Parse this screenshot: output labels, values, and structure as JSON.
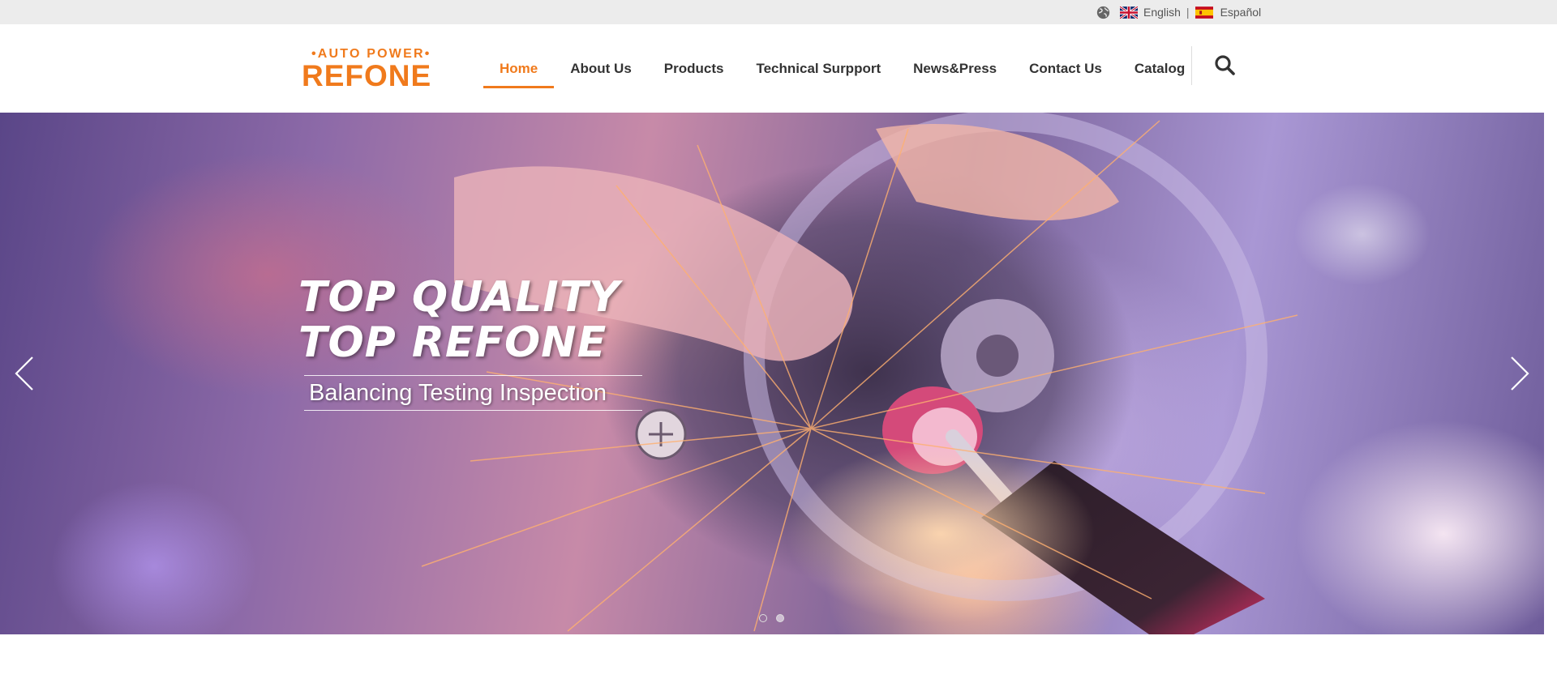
{
  "language_bar": {
    "icon": "globe-icon",
    "languages": [
      {
        "label": "English",
        "flag": "uk-flag-icon"
      },
      {
        "label": "Español",
        "flag": "spain-flag-icon"
      }
    ],
    "separator": "|"
  },
  "header": {
    "logo": {
      "tagline": "•AUTO POWER•",
      "brand": "REFONE"
    },
    "nav": [
      {
        "label": "Home",
        "active": true
      },
      {
        "label": "About Us",
        "active": false
      },
      {
        "label": "Products",
        "active": false
      },
      {
        "label": "Technical Surpport",
        "active": false
      },
      {
        "label": "News&Press",
        "active": false
      },
      {
        "label": "Contact Us",
        "active": false
      },
      {
        "label": "Catalog",
        "active": false
      }
    ],
    "search_icon": "search-icon"
  },
  "hero": {
    "headline_line1": "TOP QUALITY",
    "headline_line2": "TOP REFONE",
    "subline": "Balancing Testing Inspection",
    "prev_icon": "chevron-left-icon",
    "next_icon": "chevron-right-icon",
    "slide_count": 2,
    "active_slide": 1
  },
  "colors": {
    "accent": "#f07a1c",
    "topbar_bg": "#ececec",
    "nav_text": "#333333"
  }
}
